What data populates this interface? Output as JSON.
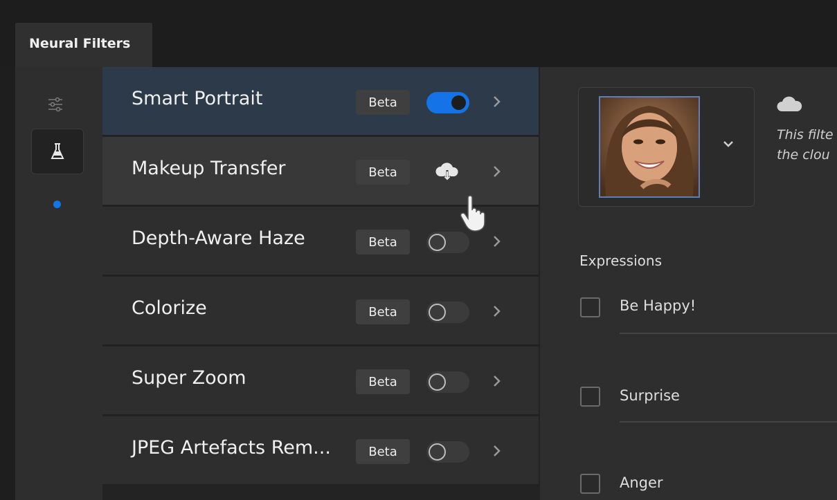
{
  "panel": {
    "tab_title": "Neural Filters"
  },
  "rail": {
    "icons": [
      "sliders-icon",
      "flask-icon"
    ]
  },
  "filters": [
    {
      "name": "Smart Portrait",
      "badge": "Beta",
      "state": "on"
    },
    {
      "name": "Makeup Transfer",
      "badge": "Beta",
      "state": "cloud-download"
    },
    {
      "name": "Depth-Aware Haze",
      "badge": "Beta",
      "state": "off"
    },
    {
      "name": "Colorize",
      "badge": "Beta",
      "state": "off"
    },
    {
      "name": "Super Zoom",
      "badge": "Beta",
      "state": "off"
    },
    {
      "name": "JPEG Artefacts Rem...",
      "badge": "Beta",
      "state": "off"
    }
  ],
  "info": {
    "line1": "This filte",
    "line2": "the clou"
  },
  "expressions": {
    "title": "Expressions",
    "items": [
      {
        "label": "Be Happy!",
        "checked": false
      },
      {
        "label": "Surprise",
        "checked": false
      },
      {
        "label": "Anger",
        "checked": false
      }
    ]
  },
  "colors": {
    "accent": "#1473e6",
    "selected_row": "#2d3a4a",
    "panel": "#2e2e2e"
  }
}
